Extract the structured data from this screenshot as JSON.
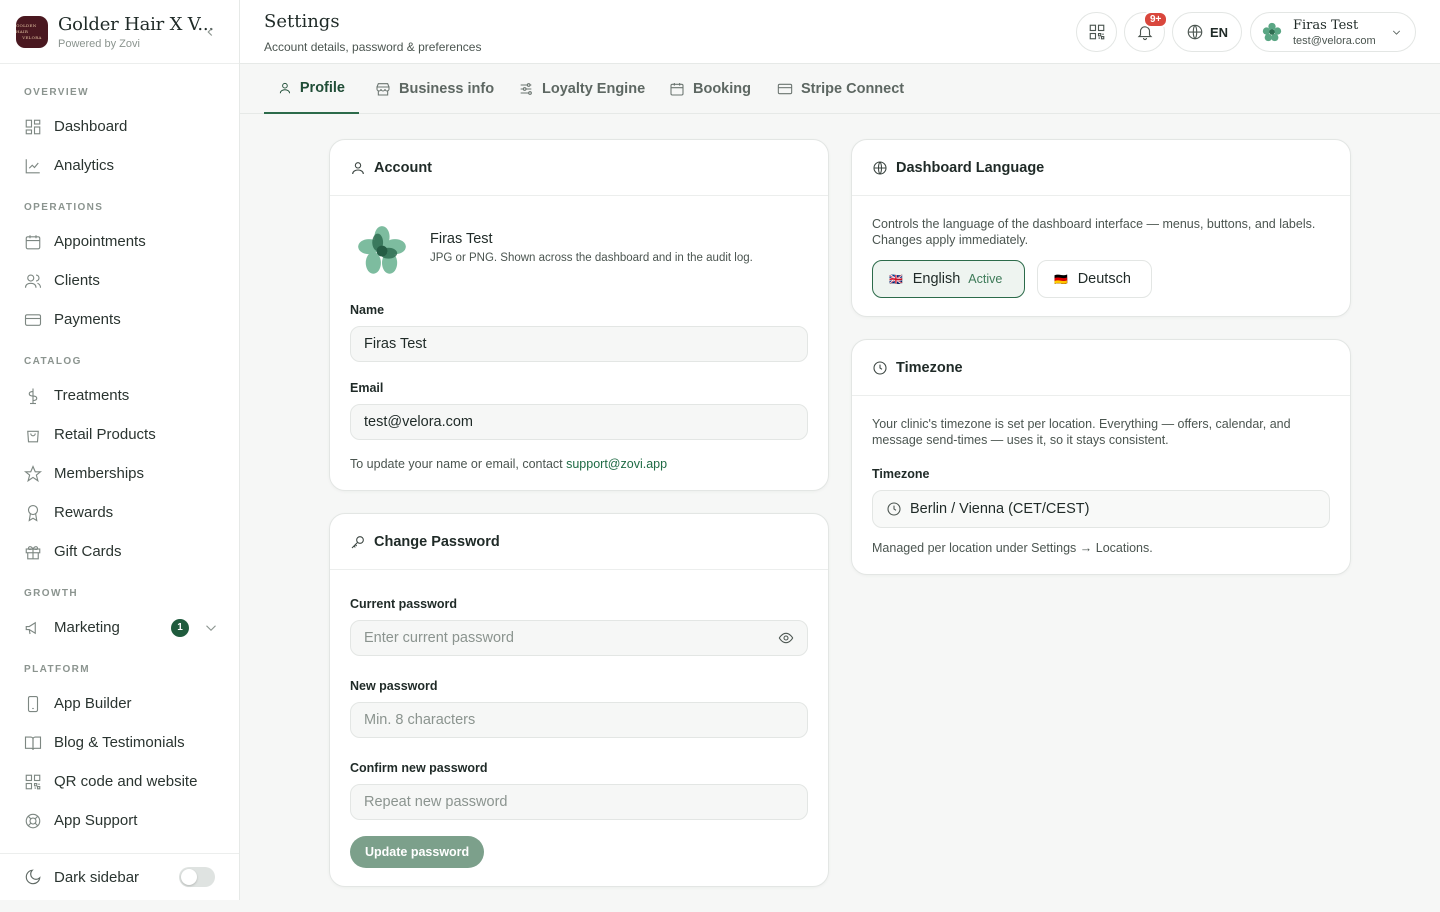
{
  "brand": {
    "name": "Golder Hair X V...",
    "sub": "Powered by Zovi",
    "logo_line1": "GOLDEN HAIR",
    "logo_line2": "VELORA"
  },
  "sidebar": {
    "sections": {
      "overview": "OVERVIEW",
      "operations": "OPERATIONS",
      "catalog": "CATALOG",
      "growth": "GROWTH",
      "platform": "PLATFORM"
    },
    "items": {
      "dashboard": "Dashboard",
      "analytics": "Analytics",
      "appointments": "Appointments",
      "clients": "Clients",
      "payments": "Payments",
      "treatments": "Treatments",
      "retail_products": "Retail Products",
      "memberships": "Memberships",
      "rewards": "Rewards",
      "gift_cards": "Gift Cards",
      "marketing": "Marketing",
      "marketing_badge": "1",
      "app_builder": "App Builder",
      "blog": "Blog & Testimonials",
      "qr": "QR code and website",
      "support": "App Support"
    },
    "dark_sidebar": "Dark sidebar"
  },
  "header": {
    "title": "Settings",
    "subtitle": "Account details, password & preferences",
    "notif_badge": "9+",
    "lang": "EN",
    "user_name": "Firas Test",
    "user_email": "test@velora.com"
  },
  "tabs": {
    "profile": "Profile",
    "business": "Business info",
    "loyalty": "Loyalty Engine",
    "booking": "Booking",
    "stripe": "Stripe Connect"
  },
  "account": {
    "title": "Account",
    "display_name": "Firas Test",
    "avatar_hint": "JPG or PNG. Shown across the dashboard and in the audit log.",
    "name_label": "Name",
    "name_value": "Firas Test",
    "email_label": "Email",
    "email_value": "test@velora.com",
    "note_prefix": "To update your name or email, contact",
    "note_link": "support@zovi.app"
  },
  "password": {
    "title": "Change Password",
    "current_label": "Current password",
    "current_placeholder": "Enter current password",
    "new_label": "New password",
    "new_placeholder": "Min. 8 characters",
    "confirm_label": "Confirm new password",
    "confirm_placeholder": "Repeat new password",
    "button": "Update password"
  },
  "language": {
    "title": "Dashboard Language",
    "desc_line1": "Controls the language of the dashboard interface — menus, buttons, and labels.",
    "desc_line2": "Changes apply immediately.",
    "english": "English",
    "english_flag": "🇬🇧",
    "active": "Active",
    "deutsch": "Deutsch",
    "deutsch_flag": "🇩🇪"
  },
  "timezone": {
    "title": "Timezone",
    "desc_line1": "Your clinic's timezone is set per location. Everything — offers, calendar, and",
    "desc_line2": "message send-times — uses it, so it stays consistent.",
    "label": "Timezone",
    "value": "Berlin / Vienna (CET/CEST)",
    "note": "Managed per location under Settings → Locations."
  },
  "colors": {
    "accent": "#1f5b3d",
    "tab_active": "#2c6b4a",
    "button_disabled": "#7ca08b",
    "notif": "#d9473d"
  }
}
